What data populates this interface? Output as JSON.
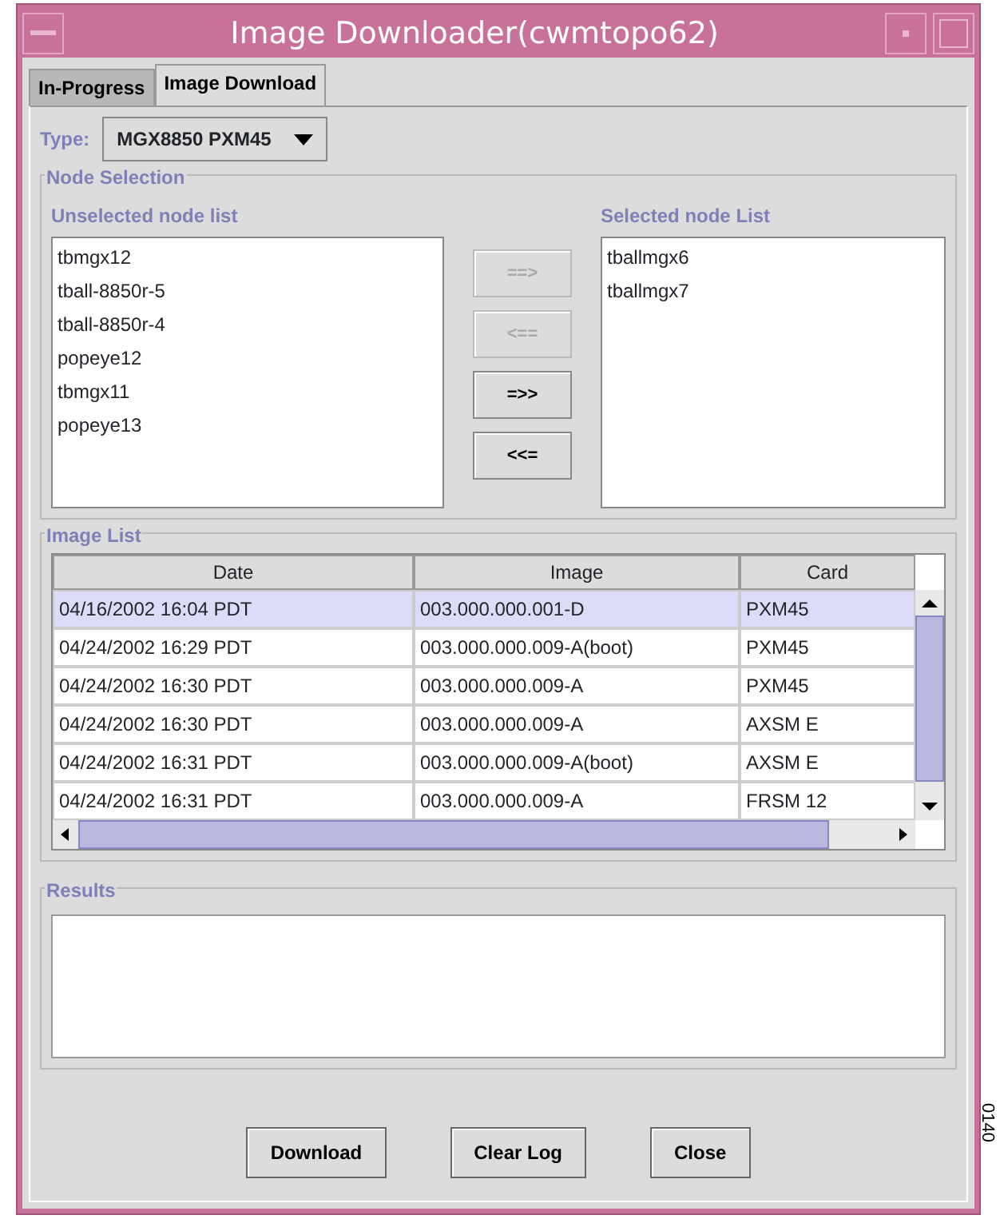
{
  "window": {
    "title": "Image Downloader(cwmtopo62)"
  },
  "tabs": [
    {
      "label": "In-Progress",
      "selected": false
    },
    {
      "label": "Image Download",
      "selected": true
    }
  ],
  "type": {
    "label": "Type:",
    "value": "MGX8850 PXM45"
  },
  "node_selection": {
    "title": "Node Selection",
    "unselected_label": "Unselected node list",
    "selected_label": "Selected node List",
    "unselected": [
      "tbmgx12",
      "tball-8850r-5",
      "tball-8850r-4",
      "popeye12",
      "tbmgx11",
      "popeye13"
    ],
    "selected": [
      "tballmgx6",
      "tballmgx7"
    ],
    "buttons": [
      {
        "label": "==>",
        "disabled": true
      },
      {
        "label": "<==",
        "disabled": true
      },
      {
        "label": "=>>",
        "disabled": false
      },
      {
        "label": "<<=",
        "disabled": false
      }
    ]
  },
  "image_list": {
    "title": "Image List",
    "columns": [
      "Date",
      "Image",
      "Card"
    ],
    "rows": [
      {
        "cells": [
          "04/16/2002 16:04 PDT",
          "003.000.000.001-D",
          "PXM45"
        ],
        "selected": true
      },
      {
        "cells": [
          "04/24/2002 16:29 PDT",
          "003.000.000.009-A(boot)",
          "PXM45"
        ],
        "selected": false
      },
      {
        "cells": [
          "04/24/2002 16:30 PDT",
          "003.000.000.009-A",
          "PXM45"
        ],
        "selected": false
      },
      {
        "cells": [
          "04/24/2002 16:30 PDT",
          "003.000.000.009-A",
          "AXSM E"
        ],
        "selected": false
      },
      {
        "cells": [
          "04/24/2002 16:31 PDT",
          "003.000.000.009-A(boot)",
          "AXSM E"
        ],
        "selected": false
      },
      {
        "cells": [
          "04/24/2002 16:31 PDT",
          "003.000.000.009-A",
          "FRSM 12"
        ],
        "selected": false
      }
    ]
  },
  "results": {
    "title": "Results"
  },
  "buttons": [
    "Download",
    "Clear Log",
    "Close"
  ],
  "side_label": "0140"
}
